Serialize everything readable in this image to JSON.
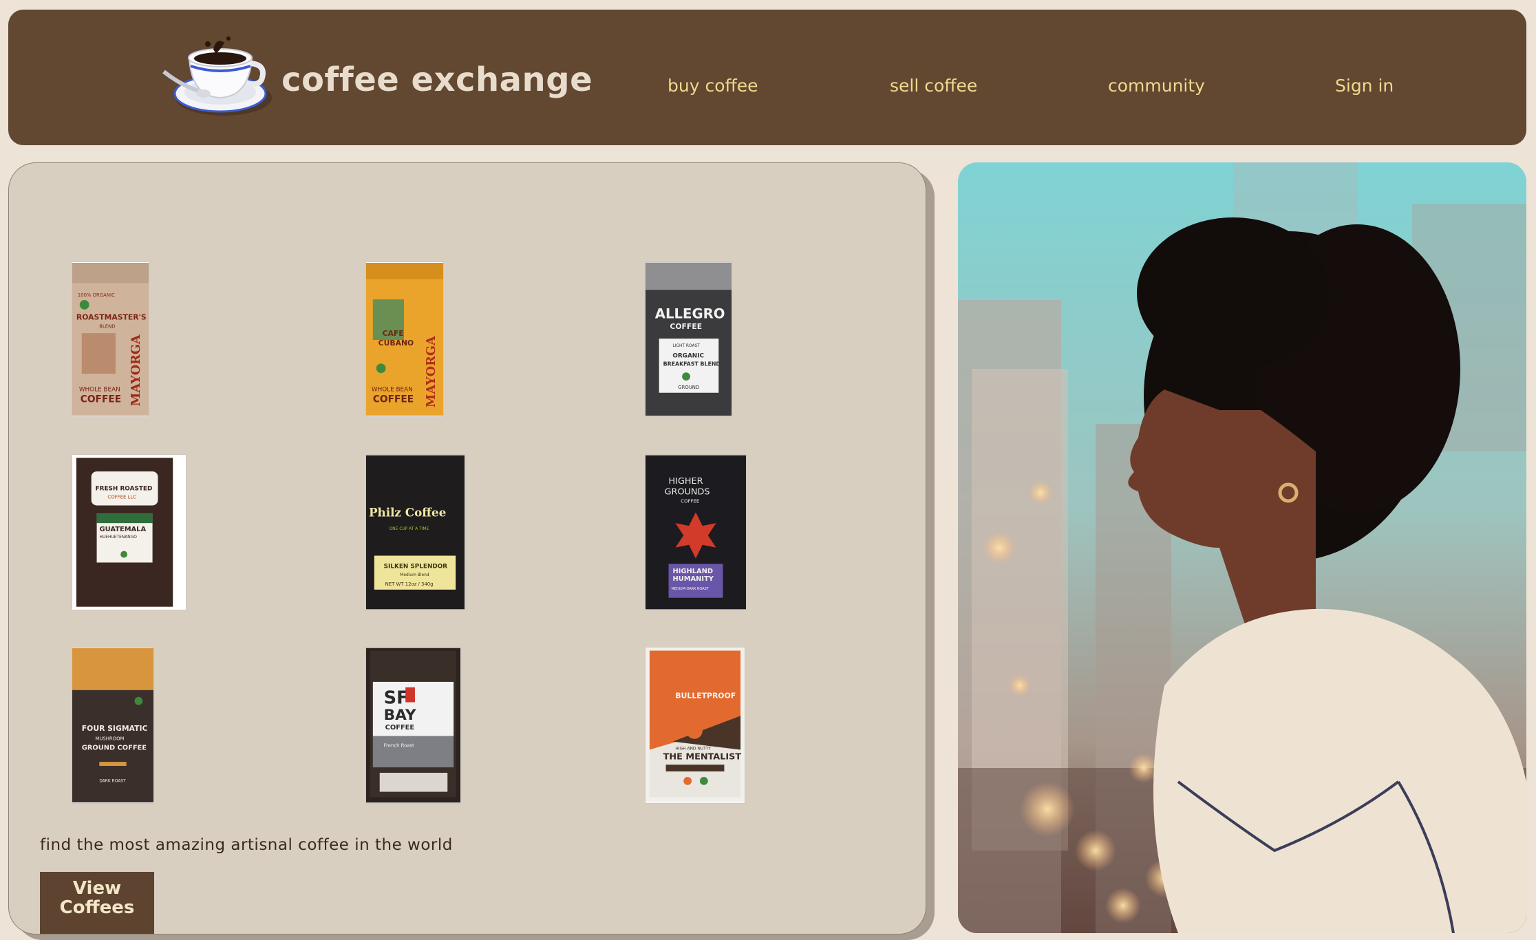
{
  "header": {
    "brand": "coffee exchange",
    "nav": {
      "buy": "buy coffee",
      "sell": "sell coffee",
      "community": "community",
      "signin": "Sign in"
    }
  },
  "products": [
    {
      "lines": [
        "100% ORGANIC",
        "ROASTMASTER'S",
        "BLEND",
        "WHOLE BEAN",
        "COFFEE",
        "MAYORGA"
      ]
    },
    {
      "lines": [
        "CAFE",
        "CUBANO",
        "WHOLE BEAN",
        "COFFEE",
        "MAYORGA"
      ]
    },
    {
      "lines": [
        "ALLEGRO",
        "COFFEE",
        "LIGHT ROAST",
        "ORGANIC",
        "BREAKFAST BLEND",
        "GROUND"
      ]
    },
    {
      "lines": [
        "FRESH ROASTED",
        "COFFEE LLC",
        "GUATEMALA",
        "HUEHUETENANGO"
      ]
    },
    {
      "lines": [
        "Philz Coffee",
        "ONE CUP AT A TIME",
        "SILKEN SPLENDOR",
        "Medium Blend",
        "NET WT 12oz / 340g"
      ]
    },
    {
      "lines": [
        "HIGHER",
        "GROUNDS",
        "COFFEE",
        "HIGHLAND",
        "HUMANITY",
        "MEDIUM-DARK ROAST"
      ]
    },
    {
      "lines": [
        "FOUR SIGMATIC",
        "MUSHROOM",
        "GROUND COFFEE",
        "DARK ROAST"
      ]
    },
    {
      "lines": [
        "SF",
        "BAY",
        "COFFEE",
        "French Roast"
      ]
    },
    {
      "lines": [
        "BULLETPROOF",
        "THE MENTALIST",
        "HIGH AND NUTTY"
      ]
    }
  ],
  "hero": {
    "tagline": "find the most amazing artisnal coffee in the world",
    "button_line1": "View",
    "button_line2": "Coffees"
  },
  "colors": {
    "header_bg": "#624731",
    "nav_text": "#f1d98d",
    "panel_bg": "#d9cfc0",
    "button_bg": "#5d4330"
  }
}
